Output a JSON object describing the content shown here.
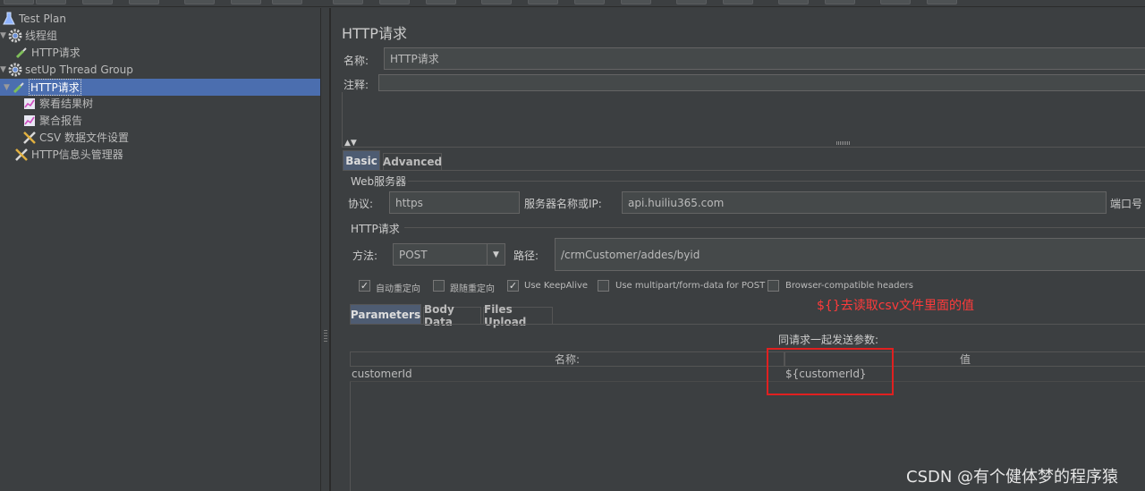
{
  "tree": {
    "items": [
      {
        "label": "Test Plan",
        "icon": "flask-icon"
      },
      {
        "label": "线程组",
        "icon": "gear-icon"
      },
      {
        "label": "HTTP请求",
        "icon": "pipette-icon"
      },
      {
        "label": "setUp Thread Group",
        "icon": "gear-icon"
      },
      {
        "label": "HTTP请求",
        "icon": "pipette-icon"
      },
      {
        "label": "察看结果树",
        "icon": "chart-icon"
      },
      {
        "label": "聚合报告",
        "icon": "chart-icon"
      },
      {
        "label": "CSV 数据文件设置",
        "icon": "wrench-icon"
      },
      {
        "label": "HTTP信息头管理器",
        "icon": "wrench-icon"
      }
    ]
  },
  "panel": {
    "title": "HTTP请求",
    "name_label": "名称:",
    "name_value": "HTTP请求",
    "comment_label": "注释:",
    "comment_value": ""
  },
  "tabs": [
    "Basic",
    "Advanced"
  ],
  "web_server": {
    "section": "Web服务器",
    "protocol_label": "协议:",
    "protocol_value": "https",
    "server_label": "服务器名称或IP:",
    "server_value": "api.huiliu365.com",
    "port_label": "端口号"
  },
  "http_request": {
    "section": "HTTP请求",
    "method_label": "方法:",
    "method_value": "POST",
    "path_label": "路径:",
    "path_value": "/crmCustomer/addes/byid",
    "options": [
      {
        "label": "自动重定向",
        "checked": true
      },
      {
        "label": "跟随重定向",
        "checked": false
      },
      {
        "label": "Use KeepAlive",
        "checked": true
      },
      {
        "label": "Use multipart/form-data for POST",
        "checked": false
      },
      {
        "label": "Browser-compatible headers",
        "checked": false
      }
    ]
  },
  "sub_tabs": [
    "Parameters",
    "Body Data",
    "Files Upload"
  ],
  "params": {
    "caption": "同请求一起发送参数:",
    "columns": [
      "名称:",
      "值"
    ],
    "rows": [
      {
        "name": "customerId",
        "value": "${customerId}"
      }
    ]
  },
  "annotation": "${}去读取csv文件里面的值",
  "watermark": "CSDN @有个健体梦的程序猿",
  "colors": {
    "selection": "#4b6eaf",
    "annotation": "#ff3b3b",
    "background": "#3c3f41"
  }
}
